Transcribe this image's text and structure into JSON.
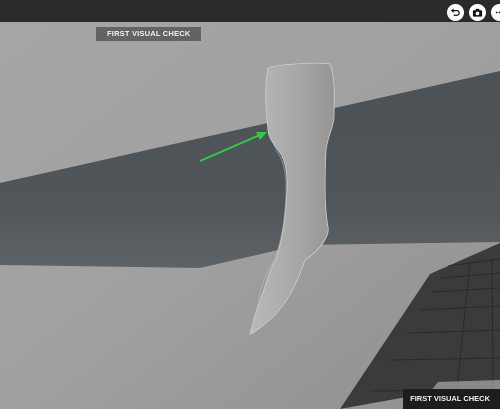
{
  "viewer": {
    "step_label": "FIRST VISUAL CHECK",
    "footer_label": "FIRST VISUAL CHECK"
  },
  "toolbar": {
    "buttons": [
      {
        "icon": "undo-icon"
      },
      {
        "icon": "camera-icon"
      },
      {
        "icon": "more-icon"
      }
    ]
  },
  "colors": {
    "panel_light": "#9c9c9c",
    "panel_dark_band": "#4c5256",
    "floor_grid": "#3b3b3b",
    "arrow": "#2ecc40"
  }
}
